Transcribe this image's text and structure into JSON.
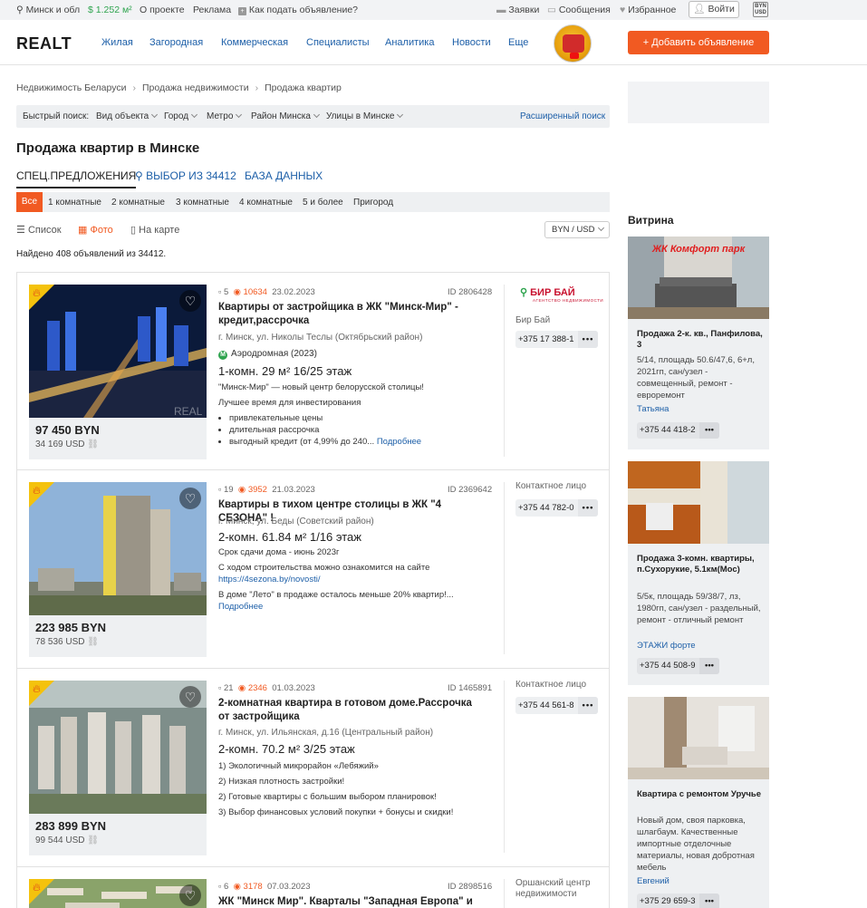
{
  "topbar": {
    "location": "Минск и обл",
    "rate": "$ 1.252 м²",
    "about": "О проекте",
    "ads": "Реклама",
    "how_to": "Как подать объявление?",
    "requests": "Заявки",
    "messages": "Сообщения",
    "favorites": "Избранное",
    "login": "Войти",
    "currency_badge_top": "BYN",
    "currency_badge_bottom": "USD"
  },
  "header": {
    "logo": "REALT",
    "nav": [
      "Жилая",
      "Загородная",
      "Коммерческая",
      "Специалисты",
      "Аналитика",
      "Новости",
      "Еще"
    ],
    "add_button": "Добавить объявление"
  },
  "breadcrumbs": [
    "Недвижимость Беларуси",
    "Продажа недвижимости",
    "Продажа квартир"
  ],
  "quick_search": {
    "label": "Быстрый поиск:",
    "filters": [
      "Вид объекта",
      "Город",
      "Метро",
      "Район Минска",
      "Улицы в Минске"
    ],
    "advanced": "Расширенный поиск"
  },
  "page_title": "Продажа квартир в Минске",
  "tabs": {
    "special": "СПЕЦ.ПРЕДЛОЖЕНИЯ",
    "selection": "ВЫБОР ИЗ 34412",
    "database": "БАЗА ДАННЫХ"
  },
  "rooms": [
    "Все",
    "1 комнатные",
    "2 комнатные",
    "3 комнатные",
    "4 комнатные",
    "5 и более",
    "Пригород"
  ],
  "views": {
    "list": "Список",
    "photo": "Фото",
    "map": "На карте",
    "currency": "BYN / USD"
  },
  "found_text": "Найдено 408 объявлений из 34412.",
  "listings": [
    {
      "comments": "5",
      "views": "10634",
      "date": "23.02.2023",
      "id": "ID 2806428",
      "title": "Квартиры от застройщика в ЖК \"Минск-Мир\" - кредит,рассрочка",
      "address": "г. Минск, ул. Николы Теслы (Октябрьский район)",
      "metro": "Аэродромная (2023)",
      "params": "1-комн.   29 м²   16/25 этаж",
      "desc1": "\"Минск-Мир\" — новый центр белорусской столицы!",
      "desc2": "Лучшее время для инвестирования",
      "bullets": [
        "привлекательные цены",
        "длительная рассрочка",
        "выгодный кредит (от 4,99% до 240..."
      ],
      "more": "Подробнее",
      "price_byn": "97 450 BYN",
      "price_usd": "34 169 USD",
      "logo_name": "БИР БАЙ",
      "logo_sub": "АГЕНТСТВО НЕДВИЖИМОСТИ",
      "contact": "Бир Бай",
      "phone": "+375 17 388-1"
    },
    {
      "comments": "19",
      "views": "3952",
      "date": "21.03.2023",
      "id": "ID 2369642",
      "title": "Квартиры в тихом центре столицы в ЖК \"4 СЕЗОНА\" !",
      "address": "г. Минск, ул. Беды (Советский район)",
      "params": "2-комн.   61.84 м²   1/16 этаж",
      "desc1": "Срок сдачи дома - июнь 2023г",
      "desc2": "С ходом строительства можно ознакомится на сайте",
      "link": "https://4sezona.by/novosti/",
      "desc3": "В доме \"Лето\" в продаже осталось меньше 20% квартир!...",
      "more": "Подробнее",
      "price_byn": "223 985 BYN",
      "price_usd": "78 536 USD",
      "contact": "Контактное лицо",
      "phone": "+375 44 782-0"
    },
    {
      "comments": "21",
      "views": "2346",
      "date": "01.03.2023",
      "id": "ID 1465891",
      "title": "2-комнатная квартира в готовом доме.Рассрочка от застройщика",
      "address": "г. Минск, ул. Ильянская, д.16 (Центральный район)",
      "params": "2-комн.   70.2 м²   3/25 этаж",
      "lines": [
        "1) Экологичный микрорайон «Лебяжий»",
        "2) Низкая плотность застройки!",
        "2) Готовые квартиры с большим выбором планировок!",
        "3) Выбор финансовых условий покупки + бонусы и скидки!"
      ],
      "price_byn": "283 899 BYN",
      "price_usd": "99 544 USD",
      "contact": "Контактное лицо",
      "phone": "+375 44 561-8"
    },
    {
      "comments": "6",
      "views": "3178",
      "date": "07.03.2023",
      "id": "ID 2898516",
      "title": "ЖК \"Минск Мир\". Кварталы \"Западная Европа\" и",
      "contact": "Оршанский центр недвижимости"
    }
  ],
  "vitrina": {
    "heading": "Витрина",
    "cards": [
      {
        "img_text": "ЖК Комфорт парк",
        "title": "Продажа 2-к. кв., Панфилова, 3",
        "desc": "5/14, площадь 50.6/47,6, 6+л, 2021гп, сан/узел - совмещенный, ремонт - евроремонт",
        "agent": "Татьяна",
        "phone": "+375 44 418-2"
      },
      {
        "title": "Продажа 3-комн. квартиры, п.Сухорукие, 5.1км(Мос)",
        "desc": "5/5к, площадь 59/38/7, лз, 1980гп, сан/узел - раздельный, ремонт - отличный ремонт",
        "agent": "ЭТАЖИ форте",
        "phone": "+375 44 508-9"
      },
      {
        "title": "Квартира с ремонтом Уручье",
        "desc": "Новый дом, своя парковка, шлагбаум. Качественные импортные отделочные материалы, новая добротная мебель",
        "agent": "Евгений",
        "phone": "+375 29 659-3"
      }
    ]
  },
  "colors": {
    "accent": "#f15a22",
    "link": "#1d5fa8",
    "green": "#2fa44f",
    "highlight": "#f4c20d"
  }
}
